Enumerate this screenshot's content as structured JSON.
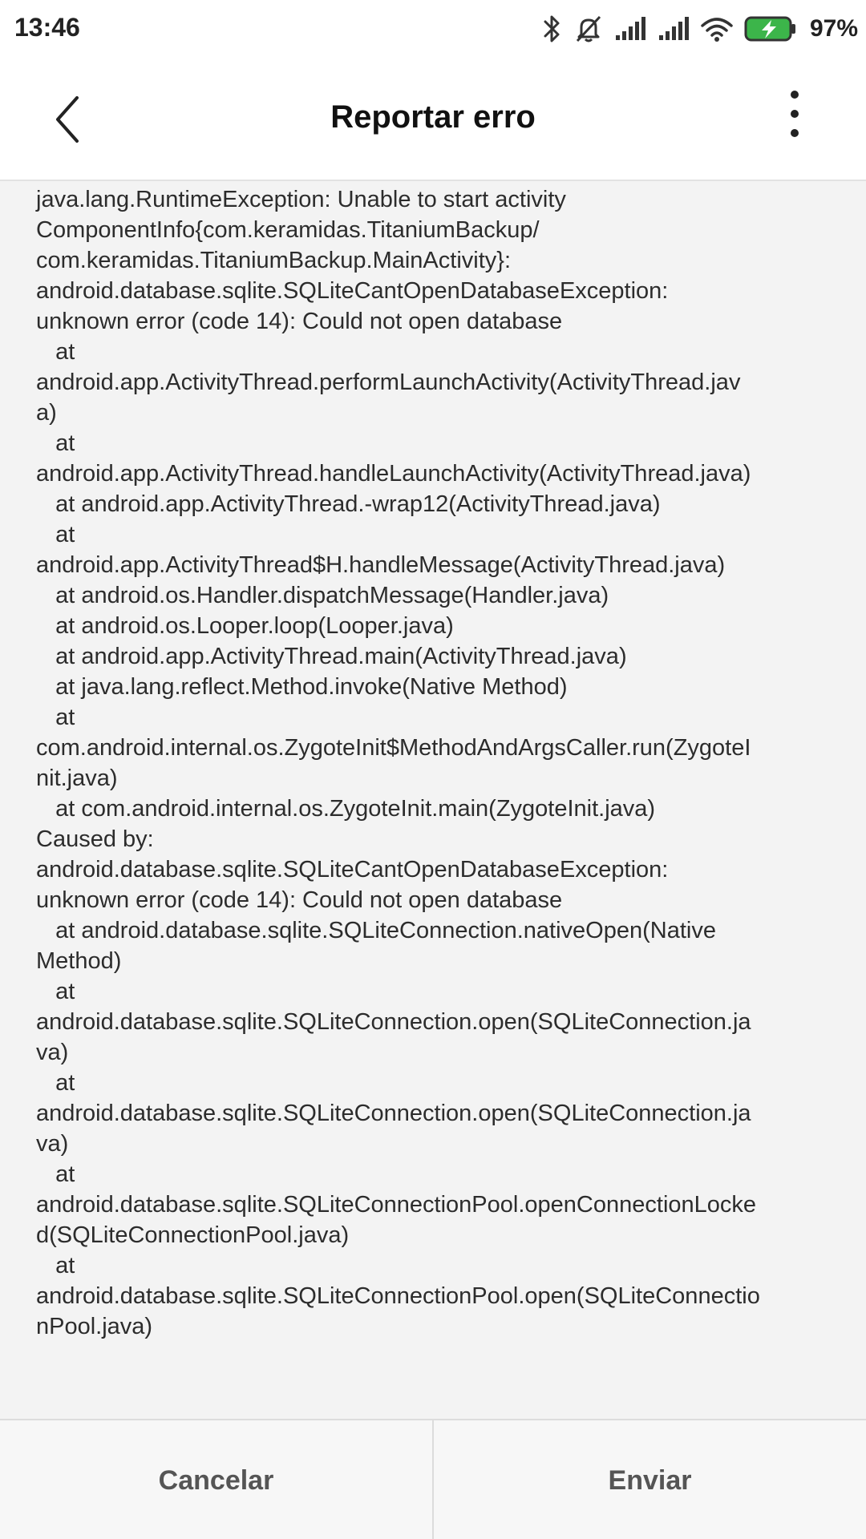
{
  "status_bar": {
    "time": "13:46",
    "battery_percent": "97%",
    "icons": [
      "bluetooth-icon",
      "alarm-off-icon",
      "signal-1-icon",
      "signal-2-icon",
      "wifi-icon",
      "battery-charging-icon"
    ],
    "battery_color": "#3cb54a"
  },
  "header": {
    "title": "Reportar erro",
    "back_icon": "chevron-left-icon",
    "menu_icon": "more-vertical-icon"
  },
  "log": {
    "lines": [
      "java.lang.RuntimeException: Unable to start activity",
      "ComponentInfo{com.keramidas.TitaniumBackup/",
      "com.keramidas.TitaniumBackup.MainActivity}:",
      "android.database.sqlite.SQLiteCantOpenDatabaseException:",
      "unknown error (code 14): Could not open database",
      "   at",
      "android.app.ActivityThread.performLaunchActivity(ActivityThread.jav",
      "a)",
      "   at",
      "android.app.ActivityThread.handleLaunchActivity(ActivityThread.java)",
      "   at android.app.ActivityThread.-wrap12(ActivityThread.java)",
      "   at",
      "android.app.ActivityThread$H.handleMessage(ActivityThread.java)",
      "   at android.os.Handler.dispatchMessage(Handler.java)",
      "   at android.os.Looper.loop(Looper.java)",
      "   at android.app.ActivityThread.main(ActivityThread.java)",
      "   at java.lang.reflect.Method.invoke(Native Method)",
      "   at",
      "com.android.internal.os.ZygoteInit$MethodAndArgsCaller.run(ZygoteI",
      "nit.java)",
      "   at com.android.internal.os.ZygoteInit.main(ZygoteInit.java)",
      "Caused by:",
      "android.database.sqlite.SQLiteCantOpenDatabaseException:",
      "unknown error (code 14): Could not open database",
      "   at android.database.sqlite.SQLiteConnection.nativeOpen(Native",
      "Method)",
      "   at",
      "android.database.sqlite.SQLiteConnection.open(SQLiteConnection.ja",
      "va)",
      "   at",
      "android.database.sqlite.SQLiteConnection.open(SQLiteConnection.ja",
      "va)",
      "   at",
      "android.database.sqlite.SQLiteConnectionPool.openConnectionLocke",
      "d(SQLiteConnectionPool.java)",
      "   at",
      "android.database.sqlite.SQLiteConnectionPool.open(SQLiteConnectio",
      "nPool.java)"
    ]
  },
  "footer": {
    "cancel_label": "Cancelar",
    "send_label": "Enviar"
  }
}
